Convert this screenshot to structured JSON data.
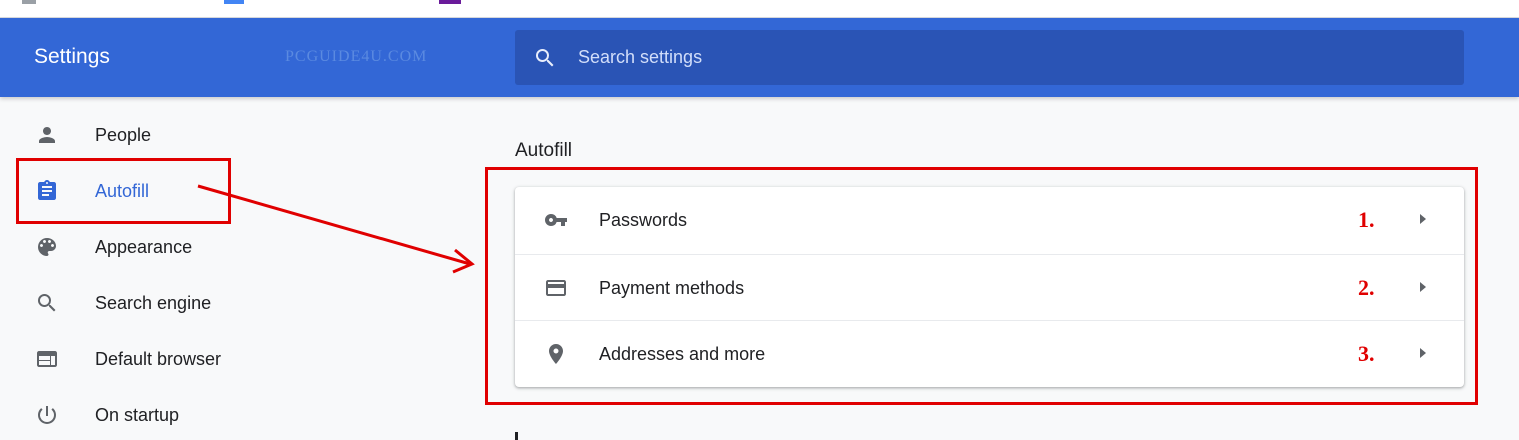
{
  "header": {
    "title": "Settings",
    "watermark": "PCGUIDE4U.COM",
    "search": {
      "placeholder": "Search settings",
      "value": ""
    }
  },
  "sidebar": {
    "items": [
      {
        "label": "People",
        "icon": "person-icon",
        "active": false
      },
      {
        "label": "Autofill",
        "icon": "clipboard-icon",
        "active": true
      },
      {
        "label": "Appearance",
        "icon": "palette-icon",
        "active": false
      },
      {
        "label": "Search engine",
        "icon": "search-icon",
        "active": false
      },
      {
        "label": "Default browser",
        "icon": "browser-window-icon",
        "active": false
      },
      {
        "label": "On startup",
        "icon": "power-icon",
        "active": false
      }
    ]
  },
  "main": {
    "section_title": "Autofill",
    "rows": [
      {
        "label": "Passwords",
        "icon": "key-icon",
        "annotation": "1."
      },
      {
        "label": "Payment methods",
        "icon": "credit-card-icon",
        "annotation": "2."
      },
      {
        "label": "Addresses and more",
        "icon": "location-pin-icon",
        "annotation": "3."
      }
    ]
  },
  "colors": {
    "header_blue": "#3367d6",
    "search_blue": "#2a54b5",
    "accent": "#3367d6",
    "annotation_red": "#e00000",
    "icon_gray": "#5f6368",
    "background": "#f8f9fa"
  }
}
